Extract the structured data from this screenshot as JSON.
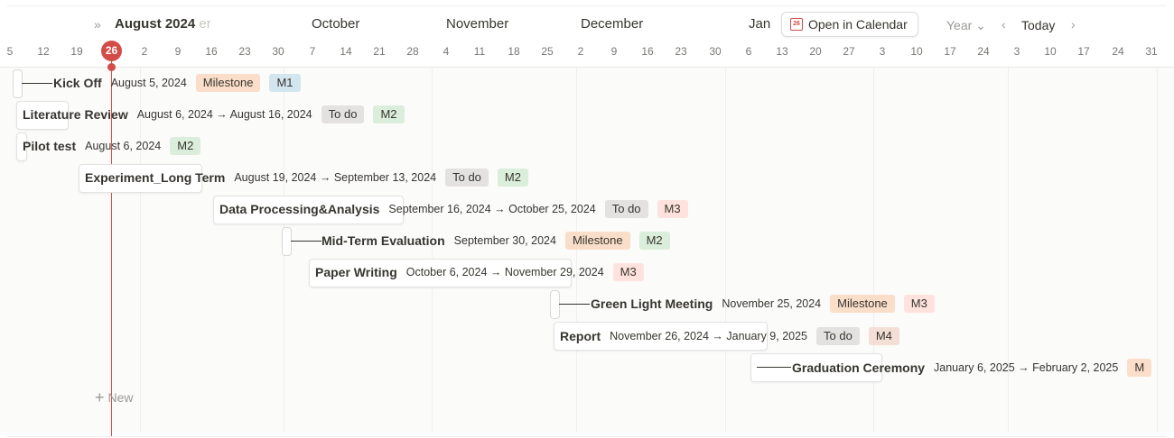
{
  "header": {
    "nav_arrows": "»",
    "current_month": "August 2024",
    "faded_month_tail": "er",
    "months": [
      "October",
      "November",
      "December"
    ],
    "jan_partial": "Jan",
    "open_calendar_label": "Open in Calendar",
    "calendar_icon_text": "26",
    "year_label": "Year",
    "year_chevron": "⌄",
    "prev_label": "‹",
    "today_label": "Today",
    "next_label": "›",
    "today_day": "26",
    "days": [
      "5",
      "12",
      "19",
      "26",
      "2",
      "9",
      "16",
      "23",
      "30",
      "7",
      "14",
      "21",
      "28",
      "4",
      "11",
      "18",
      "25",
      "2",
      "9",
      "16",
      "23",
      "30",
      "6",
      "13",
      "20",
      "27",
      "3",
      "10",
      "17",
      "24",
      "3",
      "10",
      "17",
      "24",
      "31"
    ]
  },
  "tasks": [
    {
      "title": "Kick Off",
      "date": "August 5, 2024",
      "tags": [
        "Milestone",
        "M1"
      ]
    },
    {
      "title": "Literature Review",
      "date": "August 6, 2024 → August 16, 2024",
      "tags": [
        "To do",
        "M2"
      ]
    },
    {
      "title": "Pilot test",
      "date": "August 6, 2024",
      "tags": [
        "M2"
      ]
    },
    {
      "title": "Experiment_Long Term",
      "date": "August 19, 2024 → September 13, 2024",
      "tags": [
        "To do",
        "M2"
      ]
    },
    {
      "title": "Data Processing&Analysis",
      "date": "September 16, 2024 → October 25, 2024",
      "tags": [
        "To do",
        "M3"
      ]
    },
    {
      "title": "Mid-Term Evaluation",
      "date": "September 30, 2024",
      "tags": [
        "Milestone",
        "M2"
      ]
    },
    {
      "title": "Paper Writing",
      "date": "October 6, 2024 → November 29, 2024",
      "tags": [
        "M3"
      ]
    },
    {
      "title": "Green Light Meeting",
      "date": "November 25, 2024",
      "tags": [
        "Milestone",
        "M3"
      ]
    },
    {
      "title": "Report",
      "date": "November 26, 2024 → January 9, 2025",
      "tags": [
        "To do",
        "M4"
      ]
    },
    {
      "title": "Graduation Ceremony",
      "date": "January 6, 2025 → February 2, 2025",
      "tags": [
        "M"
      ]
    }
  ],
  "new_label": "New",
  "colors": {
    "today": "#d44c47",
    "milestone": "#fadec9",
    "todo": "#e3e2e0",
    "m1": "#d3e5ef",
    "m2": "#dbeddb",
    "m3": "#ffe2dd",
    "m4": "#f4dfd6"
  }
}
